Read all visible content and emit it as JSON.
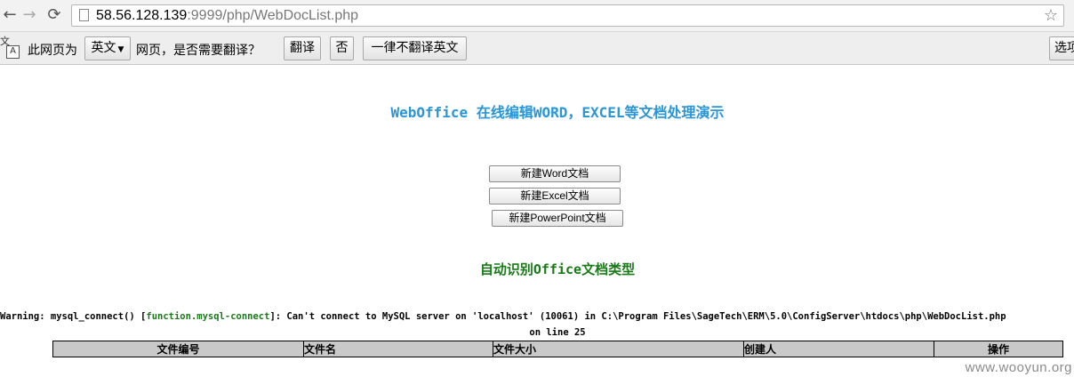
{
  "browser": {
    "url_host": "58.56.128.139",
    "url_rest": ":9999/php/WebDocList.php"
  },
  "translate_bar": {
    "prefix": "此网页为",
    "language": "英文",
    "question": "网页，是否需要翻译？",
    "translate_label": "翻译",
    "no_label": "否",
    "never_label": "一律不翻译英文",
    "options_label": "选项"
  },
  "page": {
    "title": "WebOffice 在线编辑WORD，EXCEL等文档处理演示",
    "buttons": {
      "new_word": "新建Word文档",
      "new_excel": "新建Excel文档",
      "new_ppt": "新建PowerPoint文档"
    },
    "subtitle": "自动识别Office文档类型",
    "warning": {
      "prefix": "Warning: mysql_connect() [",
      "function": "function.mysql-connect",
      "suffix": "]: Can't connect to MySQL server on 'localhost' (10061) in C:\\Program Files\\SageTech\\ERM\\5.0\\ConfigServer\\htdocs\\php\\WebDocList.php",
      "line": "on line 25"
    },
    "table": {
      "headers": [
        "文件编号",
        "文件名",
        "文件大小",
        "创建人",
        "操作"
      ]
    }
  },
  "watermark": "www.wooyun.org"
}
